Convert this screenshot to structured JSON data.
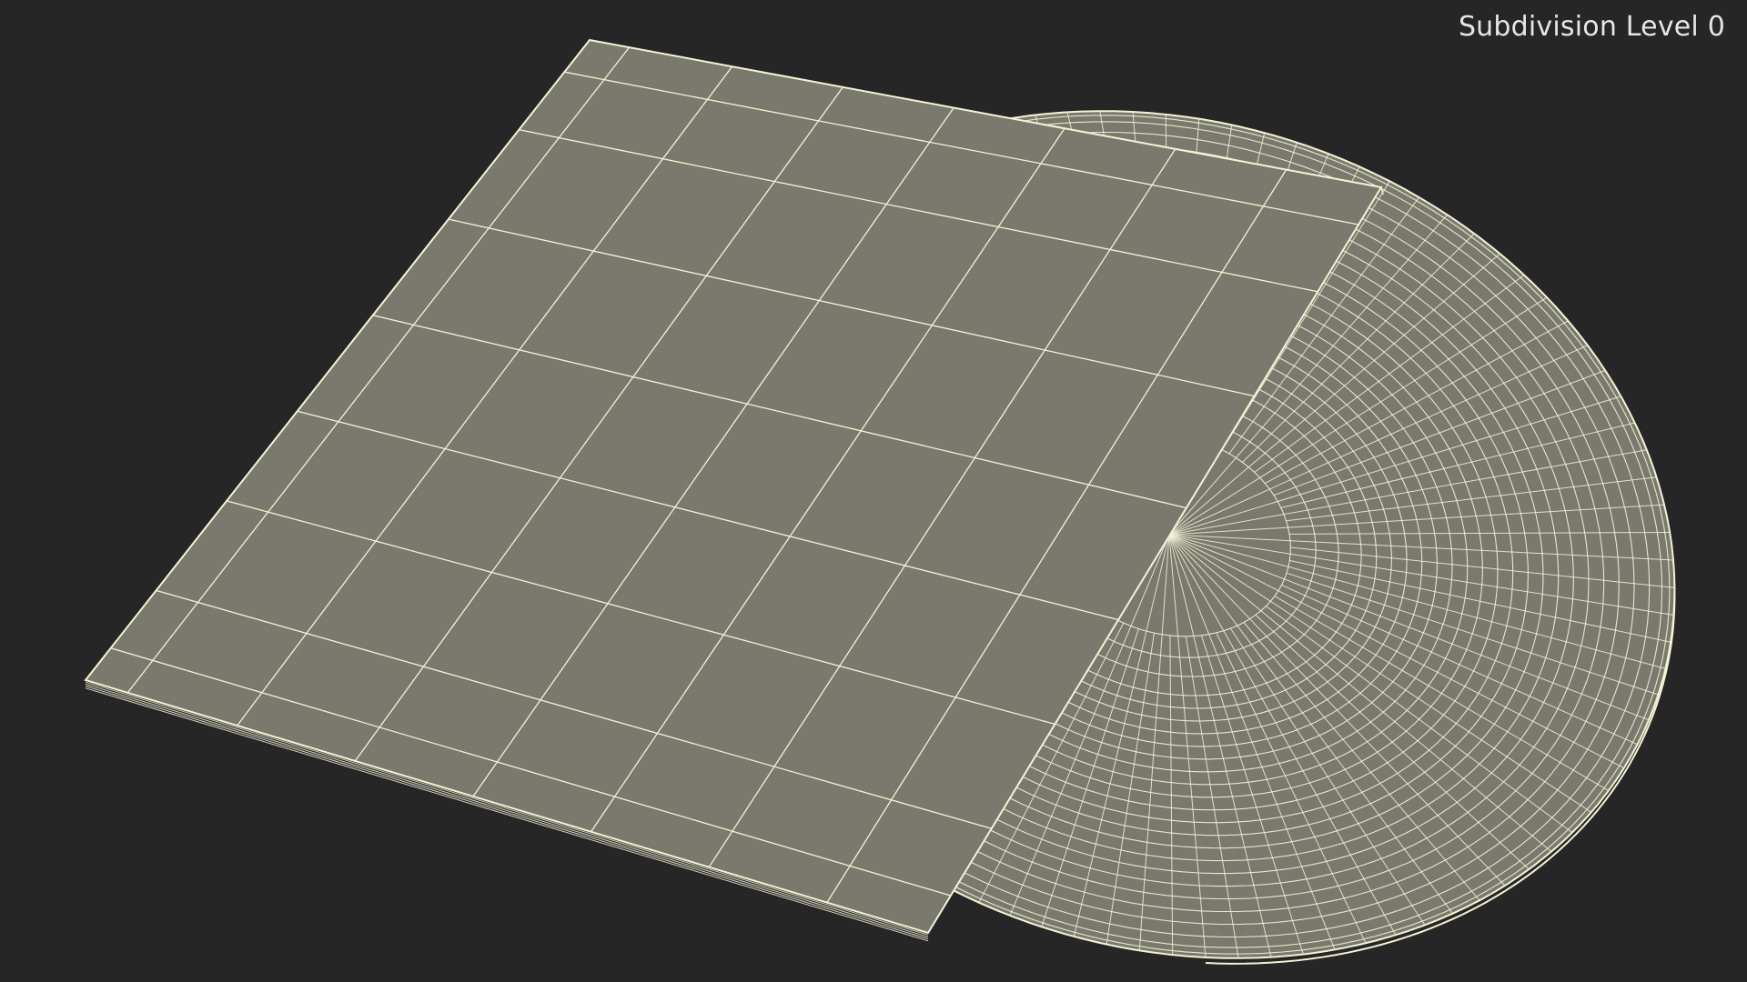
{
  "viewport": {
    "label": "Subdivision Level 0",
    "background": "#262626",
    "surface_color": "#797a6d",
    "wire_color": "#f4f2d6"
  },
  "model": {
    "parts": [
      "album-sleeve",
      "vinyl-record"
    ]
  }
}
